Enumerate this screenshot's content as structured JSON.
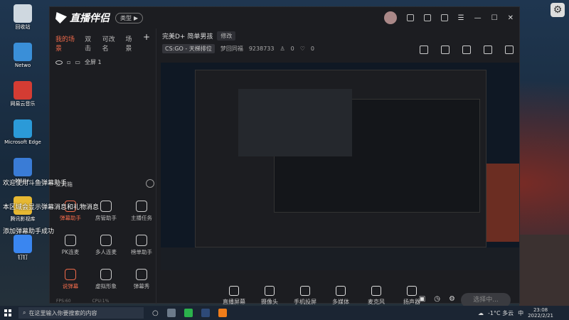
{
  "desktop": {
    "icons": [
      {
        "label": "回收站",
        "color": "#cfd8e0"
      },
      {
        "label": "Netwo",
        "color": "#3a8fd8"
      },
      {
        "label": "网易云音乐",
        "color": "#d43c33"
      },
      {
        "label": "Microsoft Edge",
        "color": "#2b9ad8"
      },
      {
        "label": "MIUI+",
        "color": "#3a7cd6"
      },
      {
        "label": "腾讯影视库",
        "color": "#e6b832"
      },
      {
        "label": "钉钉",
        "color": "#3a86f0"
      }
    ]
  },
  "app": {
    "title": "直播伴侣",
    "pill_label": "类型",
    "scene_tabs": [
      "我的场景",
      "双击",
      "可改名",
      "场景"
    ],
    "scene_item": "全屏 1",
    "tools_header": "工具箱",
    "tools": [
      {
        "label": "弹幕助手",
        "hot": true
      },
      {
        "label": "房管助手",
        "hot": false
      },
      {
        "label": "主播任务",
        "hot": false
      },
      {
        "label": "PK连麦",
        "hot": false
      },
      {
        "label": "多人连麦",
        "hot": false
      },
      {
        "label": "榜单助手",
        "hot": false
      },
      {
        "label": "说弹幕",
        "hot": true
      },
      {
        "label": "虚拟形象",
        "hot": false
      },
      {
        "label": "弹幕秀",
        "hot": false
      }
    ],
    "stream_title": "完美D+ 简单男孩",
    "edit_label": "修改",
    "category": "CS:GO - 天梯排位",
    "streamer_name": "梦回同福",
    "room_id": "9238733",
    "fans": "0",
    "likes": "0",
    "actions": [
      "直播屏幕",
      "摄像头",
      "手机投屏",
      "多媒体",
      "麦克风",
      "扬声器"
    ],
    "live_button": "选择中...",
    "status_fps": "FPS:60",
    "status_cpu": "CPU:1%"
  },
  "danmaku": [
    "欢迎使用斗鱼弹幕助手",
    "本区域会显示弹幕消息和礼物消息",
    "添加弹幕助手成功"
  ],
  "taskbar": {
    "search_placeholder": "在这里输入你要搜索的内容",
    "weather": "-1°C 多云",
    "time": "23:08",
    "date": "2022/2/21",
    "lang": "中"
  }
}
